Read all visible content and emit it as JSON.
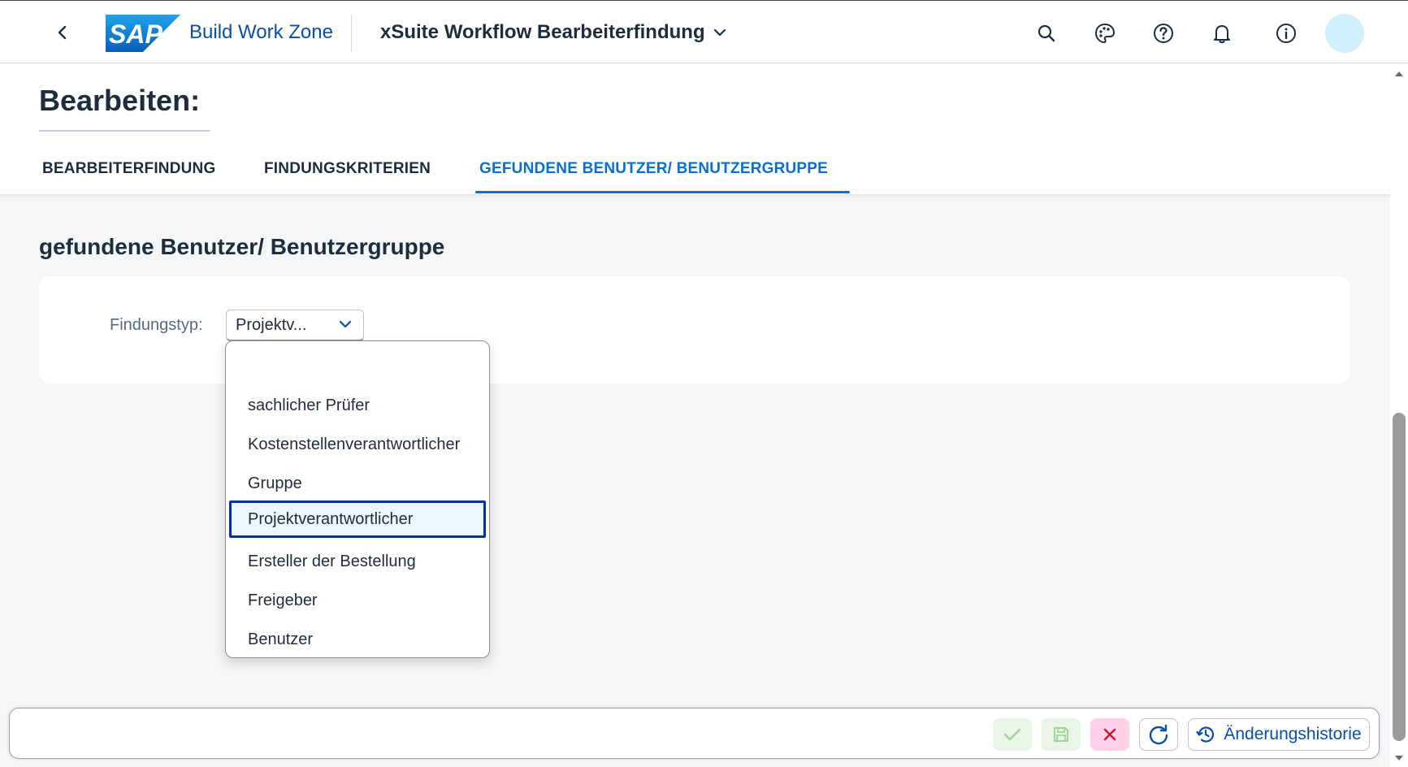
{
  "shell": {
    "logo_text": "SAP",
    "product": "Build Work Zone",
    "app_title": "xSuite Workflow Bearbeiterfindung"
  },
  "header": {
    "title": "Bearbeiten:",
    "tabs": [
      {
        "label": "BEARBEITERFINDUNG",
        "active": false
      },
      {
        "label": "FINDUNGSKRITERIEN",
        "active": false
      },
      {
        "label": "GEFUNDENE BENUTZER/ BENUTZERGRUPPE",
        "active": true
      }
    ]
  },
  "section": {
    "title": "gefundene Benutzer/ Benutzergruppe",
    "field_label": "Findungstyp:",
    "select_value": "Projektv..."
  },
  "dropdown": {
    "options": [
      "",
      "sachlicher Prüfer",
      "Kostenstellenverantwortlicher",
      "Gruppe",
      "Projektverantwortlicher",
      "Ersteller der Bestellung",
      "Freigeber",
      "Benutzer"
    ],
    "selected": "Projektverantwortlicher"
  },
  "footer": {
    "history_label": "Änderungshistorie"
  },
  "colors": {
    "brand": "#0a6ed1",
    "text": "#1d2d3e",
    "accept_bg": "#eaf5e8",
    "reject_bg": "#ffd0e7",
    "avatar": "#d1efff"
  },
  "icons": [
    "back-icon",
    "search-icon",
    "palette-icon",
    "help-icon",
    "bell-icon",
    "info-icon",
    "chevron-down-icon",
    "checkmark-icon",
    "save-icon",
    "close-icon",
    "refresh-icon",
    "history-icon"
  ]
}
